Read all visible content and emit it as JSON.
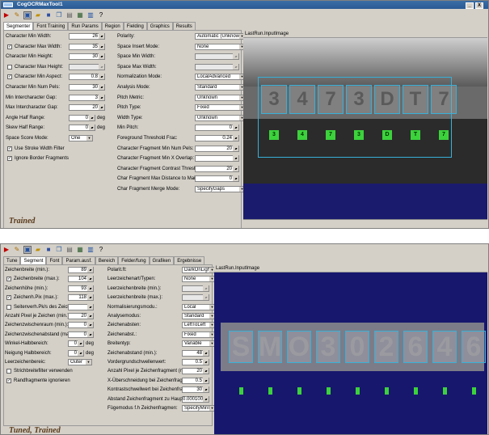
{
  "top": {
    "title": "CogOCRMaxTool1",
    "window_buttons": [
      "_",
      "X"
    ],
    "toolbar_icons": [
      "run-icon",
      "edit-icon",
      "image-icon",
      "open-icon",
      "save-icon",
      "copy-icon",
      "paste-icon",
      "grid-icon",
      "chart-icon",
      "help-icon"
    ],
    "tabs": [
      "Segmenter",
      "Font Training",
      "Run Params",
      "Region",
      "Fielding",
      "Graphics",
      "Results"
    ],
    "active_tab": "Segmenter",
    "left": [
      {
        "label": "Character Min Width:",
        "value": "26"
      },
      {
        "label": "Character Max Width:",
        "value": "35",
        "check": true
      },
      {
        "label": "Character Min Height:",
        "value": "30"
      },
      {
        "label": "Character Max Height:",
        "value": "",
        "check": false,
        "disabled": true
      },
      {
        "label": "Character Min Aspect:",
        "value": "0.8",
        "check": true
      },
      {
        "label": "Character Min Num Pels:",
        "value": "30"
      },
      {
        "label": "Min Intercharacter Gap:",
        "value": "3"
      },
      {
        "label": "Max Intercharacter Gap:",
        "value": "20"
      },
      {
        "label": "Angle Half Range:",
        "value": "0",
        "unit": "deg"
      },
      {
        "label": "Skew Half Range:",
        "value": "0",
        "unit": "deg"
      },
      {
        "label": "Space Score Mode:",
        "combo": "One"
      },
      {
        "label": "Use Stroke Width Filter",
        "check": true
      },
      {
        "label": "Ignore Border Fragments",
        "check": true
      }
    ],
    "right": [
      {
        "label": "Polarity:",
        "combo": "Automatic (Unknown)"
      },
      {
        "label": "Space Insert Mode:",
        "combo": "None"
      },
      {
        "label": "Space Min Width:",
        "value": "",
        "disabled": true
      },
      {
        "label": "Space Max Width:",
        "value": "",
        "disabled": true
      },
      {
        "label": "Normalization Mode:",
        "combo": "LocalAdvanced"
      },
      {
        "label": "Analysis Mode:",
        "combo": "Standard"
      },
      {
        "label": "Pitch Metric:",
        "combo": "Unknown"
      },
      {
        "label": "Pitch Type:",
        "combo": "Fixed"
      },
      {
        "label": "Width Type:",
        "combo": "Unknown"
      },
      {
        "label": "Min Pitch:",
        "value": "0"
      },
      {
        "label": "Foreground Threshold Frac:",
        "value": "0.24"
      },
      {
        "label": "Character Fragment Min Num Pels:",
        "value": "20"
      },
      {
        "label": "Character Fragment Min X Overlap:",
        "value": ""
      },
      {
        "label": "Character Fragment Contrast Threshold:",
        "value": "20"
      },
      {
        "label": "Char Fragment Max Distance to MainLine:",
        "value": "0"
      },
      {
        "label": "Char Fragment Merge Mode:",
        "combo": "SpecifyGaps"
      }
    ],
    "status": "Trained",
    "view_title": "LastRun.InputImage",
    "chars": [
      "3",
      "4",
      "7",
      "3",
      "D",
      "T",
      "7"
    ]
  },
  "bottom": {
    "toolbar_icons": [
      "run-icon",
      "edit-icon",
      "image-icon",
      "open-icon",
      "save-icon",
      "copy-icon",
      "paste-icon",
      "grid-icon",
      "chart-icon",
      "help-icon"
    ],
    "tabs": [
      "Tune",
      "Segment",
      "Font",
      "Param.ausf.",
      "Bereich",
      "Felder/fung",
      "Grafiken",
      "Ergebnisse"
    ],
    "active_tab": "Segment",
    "left": [
      {
        "label": "Zeichenbreite (min.):",
        "value": "89"
      },
      {
        "label": "Zeichenbreite (max.):",
        "value": "104",
        "check": true
      },
      {
        "label": "Zeichenhöhe (min.):",
        "value": "93"
      },
      {
        "label": "Zeichenh.Pix (max.):",
        "value": "118",
        "check": true
      },
      {
        "label": "Seitenverh.Pk/s des Zeichens (min.):",
        "value": "",
        "check": false
      },
      {
        "label": "Anzahl Pixel je Zeichen (min.):",
        "value": "20"
      },
      {
        "label": "Zeichenzwischenraum (min.):",
        "value": "0"
      },
      {
        "label": "Zeichenzwischenabstand (max.):",
        "value": "0"
      },
      {
        "label": "Winkel-Halbbereich:",
        "value": "0",
        "unit": "deg"
      },
      {
        "label": "Neigung Halbbereich:",
        "value": "0",
        "unit": "deg"
      },
      {
        "label": "Leerzeichenbereic:",
        "combo": "Outer"
      },
      {
        "label": "Strichbreitefilter verwenden",
        "check": false
      },
      {
        "label": "Randfragmente ignorieren",
        "check": true
      }
    ],
    "right": [
      {
        "label": "Polarit.ft:",
        "combo": "DarkOnLight"
      },
      {
        "label": "Leerzeichenart/Typen:",
        "combo": "None"
      },
      {
        "label": "Leerzeichenbreite (min.):",
        "value": "",
        "disabled": true
      },
      {
        "label": "Leerzeichenbreite (max.):",
        "value": "",
        "disabled": true
      },
      {
        "label": "Normalisierungsmodu.:",
        "combo": "Local"
      },
      {
        "label": "Analysemodus:",
        "combo": "Standard"
      },
      {
        "label": "Zeichenabsten:",
        "combo": "LeftToLeft"
      },
      {
        "label": "Zeichenabst.:",
        "combo": "Fixed"
      },
      {
        "label": "Breitentyp:",
        "combo": "Variable"
      },
      {
        "label": "Zeichenabstand (min.):",
        "value": "48"
      },
      {
        "label": "Vordergrundschwellenwert:",
        "value": "0.5"
      },
      {
        "label": "Anzahl Pixel je Zeichenfragment (min.):",
        "value": "20"
      },
      {
        "label": "X-Überschneidung bei Zeichenfragme:",
        "value": "0.5"
      },
      {
        "label": "Kontrastschwellwert bei Zeichenfragment:",
        "value": "30"
      },
      {
        "label": "Abstand Zeichenfragment zu Hauptzeile:",
        "value": "0.000100"
      },
      {
        "label": "Fügemodus f.h Zeichenfragmen:",
        "combo": "SpecifyMinInterchar/MinG"
      }
    ],
    "status": "Tuned, Trained",
    "view_title": "LastRun.InputImage",
    "chars": [
      "S",
      "M",
      "O",
      "3",
      "0",
      "2",
      "6",
      "4",
      "6"
    ]
  }
}
